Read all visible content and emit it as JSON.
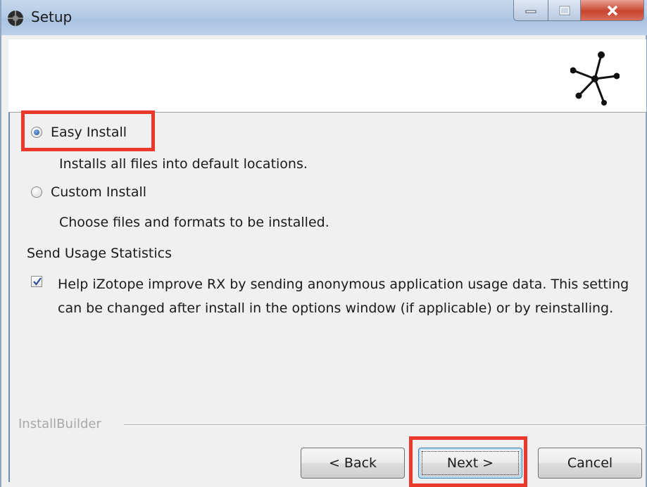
{
  "window": {
    "title": "Setup"
  },
  "options": {
    "easy": {
      "label": "Easy Install",
      "description": "Installs all files into default locations.",
      "selected": true
    },
    "custom": {
      "label": "Custom Install",
      "description": "Choose files and formats to be installed.",
      "selected": false
    }
  },
  "usage": {
    "section_label": "Send Usage Statistics",
    "checkbox_text": "Help iZotope improve RX by sending anonymous application usage data. This setting can be changed after install in the options window (if applicable) or by reinstalling.",
    "checked": true
  },
  "footer": {
    "brand": "InstallBuilder",
    "back_label": "< Back",
    "next_label": "Next >",
    "cancel_label": "Cancel"
  },
  "colors": {
    "highlight": "#e8392b",
    "radio_selected": "#1d4f8c",
    "checkmark": "#2a4f9c"
  },
  "icons": [
    "app-icon",
    "minimize-icon",
    "maximize-icon",
    "close-icon",
    "izotope-logo-icon",
    "radio-icon",
    "checkbox-icon"
  ]
}
